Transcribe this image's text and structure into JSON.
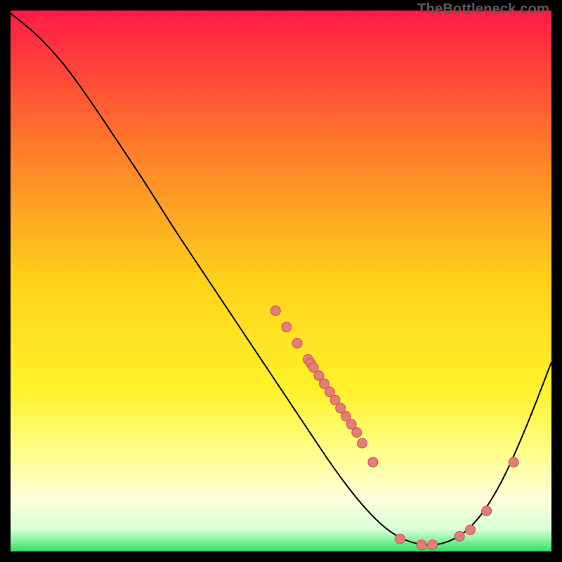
{
  "attribution": "TheBottleneck.com",
  "chart_data": {
    "type": "line",
    "title": "",
    "xlabel": "",
    "ylabel": "",
    "xlim": [
      0,
      100
    ],
    "ylim": [
      0,
      100
    ],
    "gradient_stops": [
      {
        "offset": 0,
        "color": "#ff1a46"
      },
      {
        "offset": 25,
        "color": "#ff7a2a"
      },
      {
        "offset": 50,
        "color": "#ffd21a"
      },
      {
        "offset": 70,
        "color": "#fff22a"
      },
      {
        "offset": 82,
        "color": "#ffff8d"
      },
      {
        "offset": 90,
        "color": "#ffffd8"
      },
      {
        "offset": 96,
        "color": "#d8ffd8"
      },
      {
        "offset": 100,
        "color": "#32e060"
      }
    ],
    "curve": [
      {
        "x": 0.0,
        "y": 99.5
      },
      {
        "x": 5.0,
        "y": 95.5
      },
      {
        "x": 10.0,
        "y": 90.0
      },
      {
        "x": 15.0,
        "y": 83.0
      },
      {
        "x": 20.0,
        "y": 75.5
      },
      {
        "x": 25.0,
        "y": 68.0
      },
      {
        "x": 30.0,
        "y": 60.0
      },
      {
        "x": 35.0,
        "y": 52.5
      },
      {
        "x": 40.0,
        "y": 45.0
      },
      {
        "x": 45.0,
        "y": 37.5
      },
      {
        "x": 50.0,
        "y": 30.0
      },
      {
        "x": 55.0,
        "y": 22.5
      },
      {
        "x": 60.0,
        "y": 15.0
      },
      {
        "x": 65.0,
        "y": 8.5
      },
      {
        "x": 70.0,
        "y": 3.5
      },
      {
        "x": 75.0,
        "y": 1.2
      },
      {
        "x": 80.0,
        "y": 1.2
      },
      {
        "x": 85.0,
        "y": 4.0
      },
      {
        "x": 90.0,
        "y": 11.0
      },
      {
        "x": 95.0,
        "y": 22.0
      },
      {
        "x": 100.0,
        "y": 35.0
      }
    ],
    "points": [
      {
        "x": 49.0,
        "y": 44.5
      },
      {
        "x": 51.0,
        "y": 41.5
      },
      {
        "x": 53.0,
        "y": 38.5
      },
      {
        "x": 55.0,
        "y": 35.5
      },
      {
        "x": 55.5,
        "y": 34.8
      },
      {
        "x": 56.0,
        "y": 34.0
      },
      {
        "x": 57.0,
        "y": 32.5
      },
      {
        "x": 58.0,
        "y": 31.0
      },
      {
        "x": 59.0,
        "y": 29.5
      },
      {
        "x": 60.0,
        "y": 28.0
      },
      {
        "x": 61.0,
        "y": 26.5
      },
      {
        "x": 62.0,
        "y": 25.0
      },
      {
        "x": 63.0,
        "y": 23.5
      },
      {
        "x": 64.0,
        "y": 22.0
      },
      {
        "x": 65.0,
        "y": 20.0
      },
      {
        "x": 67.0,
        "y": 16.5
      },
      {
        "x": 72.0,
        "y": 2.3
      },
      {
        "x": 76.0,
        "y": 1.2
      },
      {
        "x": 78.0,
        "y": 1.2
      },
      {
        "x": 83.0,
        "y": 2.8
      },
      {
        "x": 85.0,
        "y": 4.0
      },
      {
        "x": 88.0,
        "y": 7.5
      },
      {
        "x": 93.0,
        "y": 16.5
      }
    ],
    "point_color": "#e87a77",
    "point_stroke": "#c25856",
    "curve_color": "#000000"
  }
}
